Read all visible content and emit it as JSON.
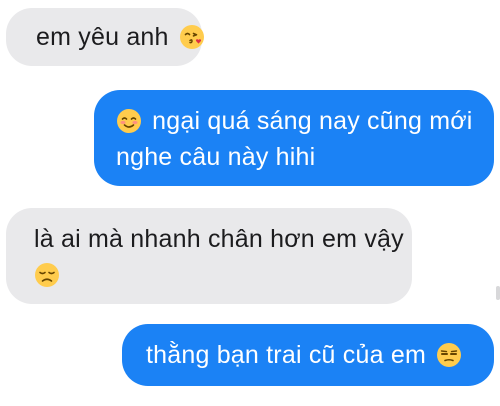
{
  "conversation": {
    "messages": [
      {
        "direction": "incoming",
        "lines": [
          {
            "text": "em yêu anh",
            "emoji_after": "face-blowing-kiss-icon"
          }
        ]
      },
      {
        "direction": "outgoing",
        "lines": [
          {
            "emoji_before": "smiling-face-icon",
            "text": "ngại quá sáng nay cũng mới"
          },
          {
            "text": "nghe câu này hihi"
          }
        ]
      },
      {
        "direction": "incoming",
        "lines": [
          {
            "text": "là ai mà nhanh chân hơn em vậy"
          },
          {
            "emoji": "disappointed-face-icon"
          }
        ]
      },
      {
        "direction": "outgoing",
        "lines": [
          {
            "text": "thằng bạn trai cũ của em",
            "emoji_after": "unamused-face-icon"
          }
        ]
      }
    ]
  },
  "colors": {
    "incoming_bubble": "#e9e9eb",
    "outgoing_bubble": "#1b82f5",
    "incoming_text": "#1c1c1e",
    "outgoing_text": "#ffffff",
    "emoji_yellow": "#ffcc4d"
  }
}
